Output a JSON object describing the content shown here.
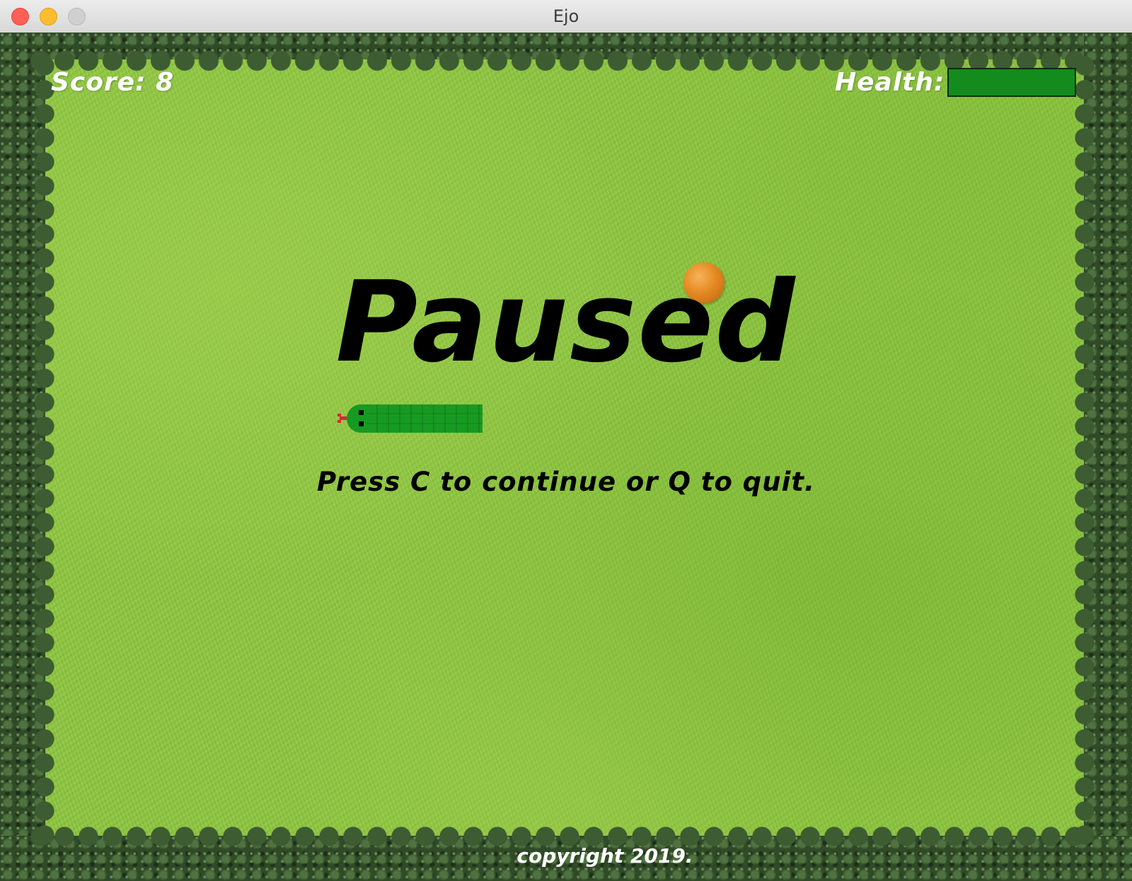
{
  "window": {
    "title": "Ejo"
  },
  "hud": {
    "score_label": "Score: 8",
    "health_label": "Health:",
    "health_fraction": 1.0,
    "health_color": "#138c1d"
  },
  "overlay": {
    "title": "Paused",
    "subtitle": "Press C to continue or Q to quit."
  },
  "footer": {
    "copyright": "copyright 2019."
  },
  "game_objects": {
    "food_icon": "orange-icon",
    "snake_icon": "snake-icon",
    "snake_direction": "left"
  },
  "colors": {
    "grass": "#8ec63f",
    "hedge": "#2f4a26",
    "snake": "#179a22",
    "text_dark": "#000000",
    "text_light": "#ffffff"
  }
}
